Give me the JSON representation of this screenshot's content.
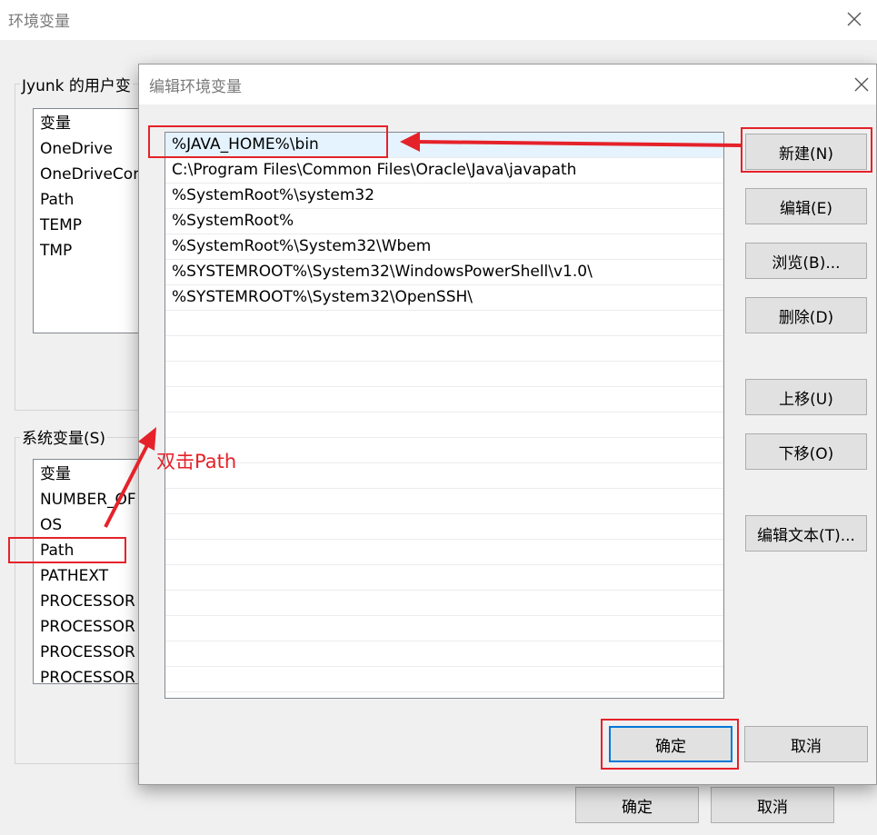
{
  "back_dialog": {
    "title": "环境变量",
    "user_group_label": "Jyunk 的用户变",
    "user_vars": {
      "header": "变量",
      "items": [
        "OneDrive",
        "OneDriveCor",
        "Path",
        "TEMP",
        "TMP"
      ]
    },
    "system_group_label": "系统变量(S)",
    "system_vars": {
      "header": "变量",
      "items": [
        "NUMBER_OF",
        "OS",
        "Path",
        "PATHEXT",
        "PROCESSOR",
        "PROCESSOR",
        "PROCESSOR",
        "PROCESSOR"
      ]
    },
    "ok_label": "确定",
    "cancel_label": "取消"
  },
  "edit_dialog": {
    "title": "编辑环境变量",
    "paths": [
      "%JAVA_HOME%\\bin",
      "C:\\Program Files\\Common Files\\Oracle\\Java\\javapath",
      "%SystemRoot%\\system32",
      "%SystemRoot%",
      "%SystemRoot%\\System32\\Wbem",
      "%SYSTEMROOT%\\System32\\WindowsPowerShell\\v1.0\\",
      "%SYSTEMROOT%\\System32\\OpenSSH\\"
    ],
    "buttons": {
      "new": "新建(N)",
      "edit": "编辑(E)",
      "browse": "浏览(B)...",
      "delete": "删除(D)",
      "move_up": "上移(U)",
      "move_down": "下移(O)",
      "edit_text": "编辑文本(T)..."
    },
    "ok_label": "确定",
    "cancel_label": "取消"
  },
  "annotations": {
    "double_click_text": "双击Path",
    "highlight_color": "#e5222a"
  }
}
